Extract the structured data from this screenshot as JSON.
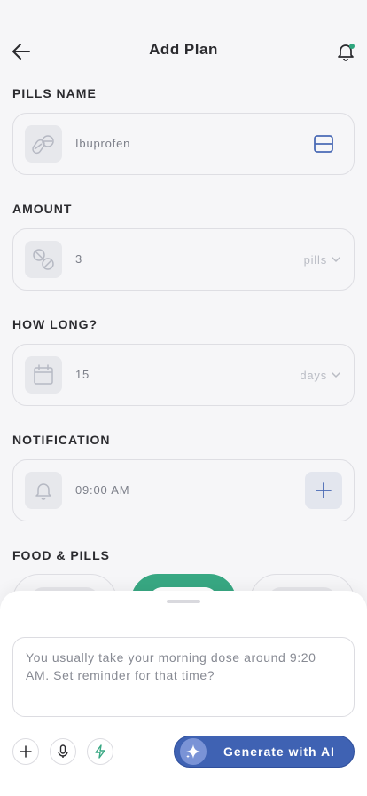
{
  "header": {
    "title": "Add Plan"
  },
  "pills_name": {
    "label": "PILLS NAME",
    "value": "Ibuprofen"
  },
  "amount": {
    "label": "AMOUNT",
    "value": "3",
    "unit": "pills"
  },
  "duration": {
    "label": "HOW LONG?",
    "value": "15",
    "unit": "days"
  },
  "notification": {
    "label": "NOTIFICATION",
    "time": "09:00 AM"
  },
  "food_pills": {
    "label": "FOOD & PILLS",
    "selected_index": 1
  },
  "assistant": {
    "prompt_text": "You usually take your morning dose around 9:20 AM. Set reminder for that time?",
    "generate_label": "Generate with AI"
  },
  "colors": {
    "accent_green": "#38a883",
    "primary_blue": "#3f62b3",
    "notification_dot": "#2fa67e"
  }
}
